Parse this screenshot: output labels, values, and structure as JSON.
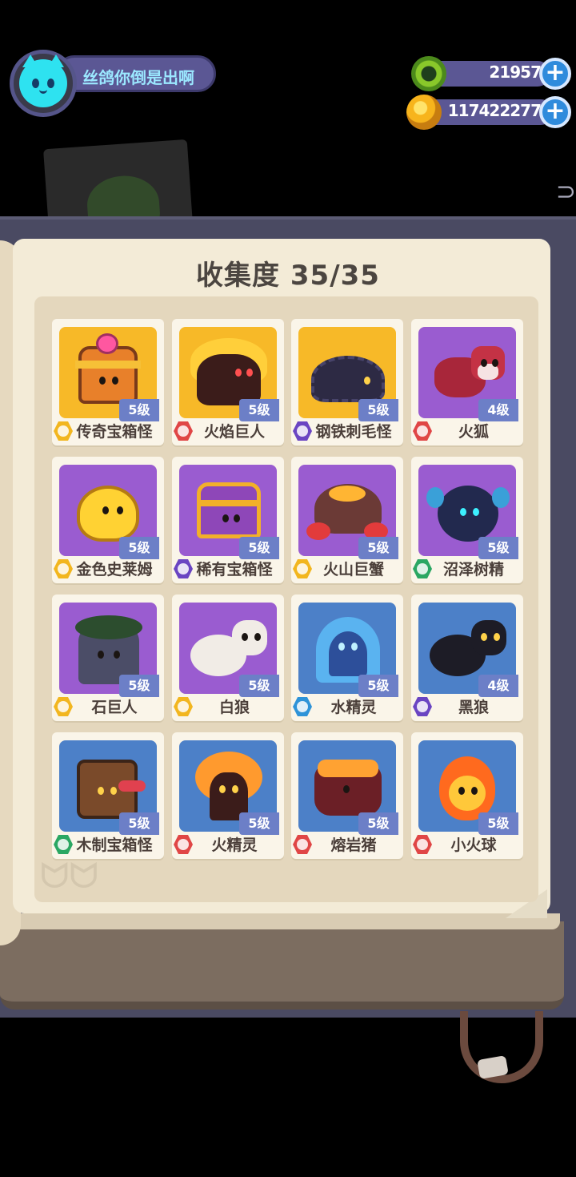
{
  "player": {
    "name": "丝鸽你倒是出啊"
  },
  "currencies": [
    {
      "icon": "gem-icon",
      "value": "21957"
    },
    {
      "icon": "coin-icon",
      "value": "117422277"
    }
  ],
  "collection": {
    "title": "收集度 35/35",
    "cards": [
      {
        "name": "传奇宝箱怪",
        "level": "5级",
        "bg": "gold",
        "element": "gold"
      },
      {
        "name": "火焰巨人",
        "level": "5级",
        "bg": "gold",
        "element": "fire"
      },
      {
        "name": "钢铁刺毛怪",
        "level": "5级",
        "bg": "gold",
        "element": "dark"
      },
      {
        "name": "火狐",
        "level": "4级",
        "bg": "purple",
        "element": "fire"
      },
      {
        "name": "金色史莱姆",
        "level": "5级",
        "bg": "purple",
        "element": "gold"
      },
      {
        "name": "稀有宝箱怪",
        "level": "5级",
        "bg": "purple",
        "element": "dark"
      },
      {
        "name": "火山巨蟹",
        "level": "5级",
        "bg": "purple",
        "element": "gold"
      },
      {
        "name": "沼泽树精",
        "level": "5级",
        "bg": "purple",
        "element": "nature"
      },
      {
        "name": "石巨人",
        "level": "5级",
        "bg": "purple",
        "element": "gold"
      },
      {
        "name": "白狼",
        "level": "5级",
        "bg": "purple",
        "element": "gold"
      },
      {
        "name": "水精灵",
        "level": "5级",
        "bg": "blue",
        "element": "water"
      },
      {
        "name": "黑狼",
        "level": "4级",
        "bg": "blue",
        "element": "dark"
      },
      {
        "name": "木制宝箱怪",
        "level": "5级",
        "bg": "blue",
        "element": "nature"
      },
      {
        "name": "火精灵",
        "level": "5级",
        "bg": "blue",
        "element": "fire"
      },
      {
        "name": "熔岩猪",
        "level": "5级",
        "bg": "blue",
        "element": "fire"
      },
      {
        "name": "小火球",
        "level": "5级",
        "bg": "blue",
        "element": "fire"
      }
    ]
  },
  "colors": {
    "gold_bg": "#f7b928",
    "purple_bg": "#9a5cd0",
    "blue_bg": "#4c80c8",
    "level_badge": "#6c7fc7",
    "hud_pill": "#5b5794",
    "page": "#f3ebd7"
  }
}
